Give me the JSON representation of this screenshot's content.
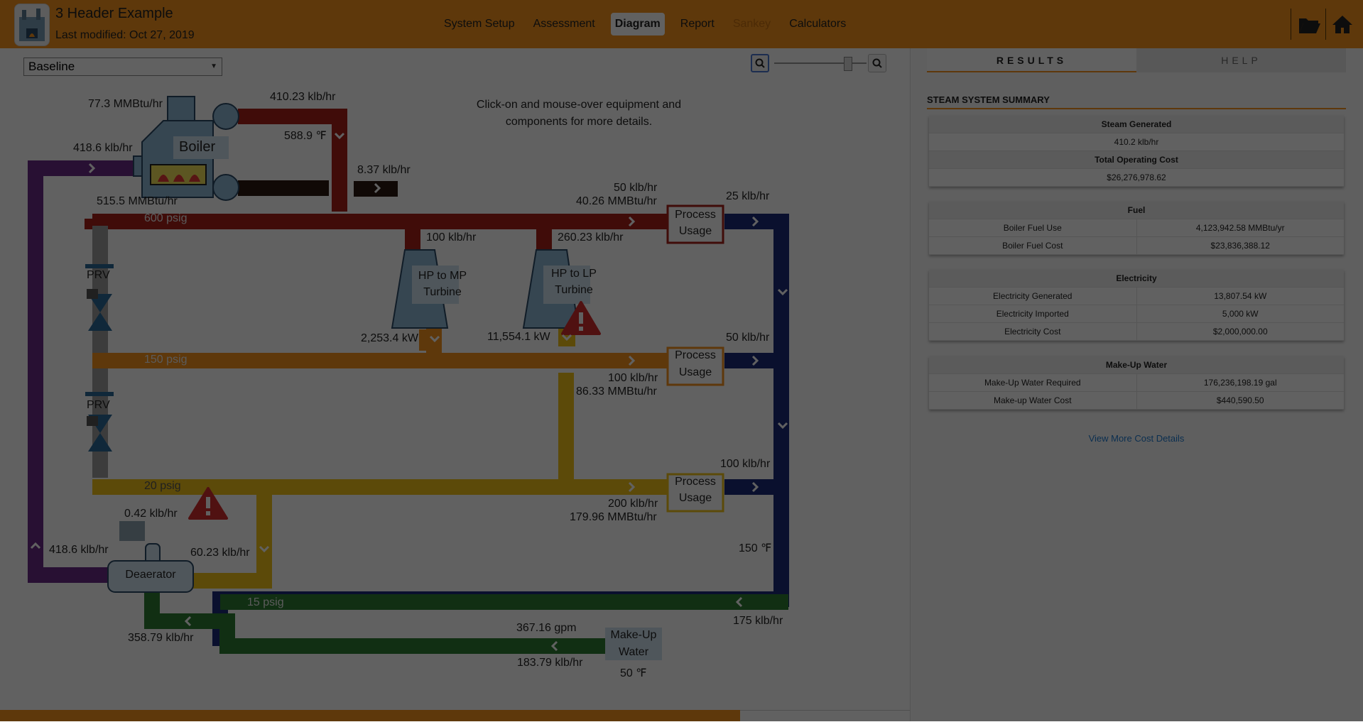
{
  "app": {
    "title": "3 Header Example",
    "last_modified": "Last modified: Oct 27, 2019"
  },
  "nav": {
    "items": [
      {
        "label": "System Setup",
        "active": false,
        "dim": false
      },
      {
        "label": "Assessment",
        "active": false,
        "dim": false
      },
      {
        "label": "Diagram",
        "active": true,
        "dim": false
      },
      {
        "label": "Report",
        "active": false,
        "dim": false
      },
      {
        "label": "Sankey",
        "active": false,
        "dim": true
      },
      {
        "label": "Calculators",
        "active": false,
        "dim": false
      }
    ],
    "folder_icon": "folder-open-icon",
    "home_icon": "home-icon"
  },
  "toolbar": {
    "scenario_select": "Baseline",
    "zoom_out_icon": "zoom-out-icon",
    "zoom_in_icon": "zoom-in-icon"
  },
  "diagram": {
    "instructions": "Click-on and mouse-over equipment and components for more details.",
    "boiler": {
      "label": "Boiler",
      "fuel": "77.3 MMBtu/hr",
      "steam_flow": "410.23 klb/hr",
      "steam_temp": "588.9 ℉",
      "feedwater": "418.6 klb/hr",
      "energy": "515.5 MMBtu/hr",
      "blowdown": "8.37 klb/hr"
    },
    "headers": {
      "hp": "600 psig",
      "mp": "150 psig",
      "lp": "20 psig",
      "condensate": "15 psig"
    },
    "prv": {
      "label": "PRV"
    },
    "turbine_hp_mp": {
      "label_1": "HP to MP",
      "label_2": "Turbine",
      "flow": "100 klb/hr",
      "power": "2,253.4 kW"
    },
    "turbine_hp_lp": {
      "label_1": "HP to LP",
      "label_2": "Turbine",
      "flow": "260.23 klb/hr",
      "power": "11,554.1 kW"
    },
    "process_usage": {
      "label_1": "Process",
      "label_2": "Usage"
    },
    "process_hp": {
      "in_flow": "50 klb/hr",
      "in_energy": "40.26 MMBtu/hr",
      "return_flow": "25 klb/hr"
    },
    "process_mp": {
      "in_flow": "100 klb/hr",
      "in_energy": "86.33 MMBtu/hr",
      "return_flow": "50 klb/hr"
    },
    "process_lp": {
      "in_flow": "200 klb/hr",
      "in_energy": "179.96 MMBtu/hr",
      "return_flow": "100 klb/hr"
    },
    "condensate": {
      "temp": "150 ℉",
      "flow": "175 klb/hr"
    },
    "deaerator": {
      "label": "Deaerator",
      "vent": "0.42 klb/hr",
      "feed_out": "418.6 klb/hr",
      "lp_in": "60.23 klb/hr",
      "water_in": "358.79 klb/hr"
    },
    "makeup_water": {
      "label_1": "Make-Up",
      "label_2": "Water",
      "gpm": "367.16 gpm",
      "flow": "183.79 klb/hr",
      "temp": "50 ℉"
    }
  },
  "sidebar": {
    "tabs": [
      {
        "label": "RESULTS",
        "active": true
      },
      {
        "label": "HELP",
        "active": false
      }
    ],
    "summary_title": "STEAM SYSTEM SUMMARY",
    "steam": {
      "header_1": "Steam Generated",
      "value_1": "410.2 klb/hr",
      "header_2": "Total Operating Cost",
      "value_2": "$26,276,978.62"
    },
    "fuel": {
      "header": "Fuel",
      "rows": [
        {
          "label": "Boiler Fuel Use",
          "value": "4,123,942.58 MMBtu/yr"
        },
        {
          "label": "Boiler Fuel Cost",
          "value": "$23,836,388.12"
        }
      ]
    },
    "electricity": {
      "header": "Electricity",
      "rows": [
        {
          "label": "Electricity Generated",
          "value": "13,807.54 kW"
        },
        {
          "label": "Electricity Imported",
          "value": "5,000 kW"
        },
        {
          "label": "Electricity Cost",
          "value": "$2,000,000.00"
        }
      ]
    },
    "makeup": {
      "header": "Make-Up Water",
      "rows": [
        {
          "label": "Make-Up Water Required",
          "value": "176,236,198.19 gal"
        },
        {
          "label": "Make-up Water Cost",
          "value": "$440,590.50"
        }
      ]
    },
    "more_link": "View More Cost Details"
  },
  "colors": {
    "accent": "#f7941d",
    "hp_steam": "#a8201a",
    "mp_steam": "#f7941d",
    "lp_steam": "#f2c21a",
    "condensate": "#1c2a7a",
    "feedwater": "#6b2a86",
    "water": "#2e7d32",
    "prv_gray": "#9e9e9e"
  }
}
